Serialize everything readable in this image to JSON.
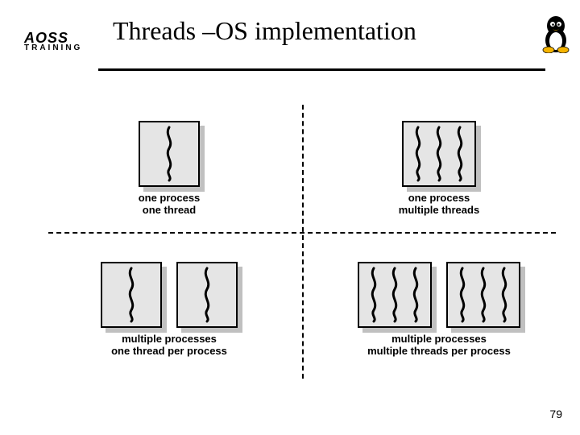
{
  "header": {
    "title": "Threads –OS implementation",
    "logo_line1": "AOSS",
    "logo_line2": "TRAINING",
    "mascot": "linux-tux-icon"
  },
  "diagram": {
    "tl": {
      "line1": "one process",
      "line2": "one thread",
      "boxes": 1,
      "threads_per_box": 1
    },
    "tr": {
      "line1": "one process",
      "line2": "multiple threads",
      "boxes": 1,
      "threads_per_box": 3
    },
    "bl": {
      "line1": "multiple processes",
      "line2": "one thread per process",
      "boxes": 2,
      "threads_per_box": 1
    },
    "br": {
      "line1": "multiple processes",
      "line2": "multiple threads per process",
      "boxes": 2,
      "threads_per_box": 3
    }
  },
  "page_number": "79"
}
